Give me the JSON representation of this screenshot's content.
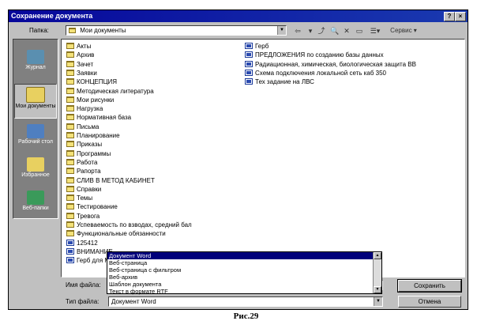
{
  "window": {
    "title": "Сохранение документа",
    "help_label": "?",
    "close_label": "×"
  },
  "location": {
    "label": "Папка:",
    "value": "Мои документы"
  },
  "toolbar": {
    "back_icon": "back-arrow-icon",
    "up_icon": "up-folder-icon",
    "search_icon": "search-web-icon",
    "delete_icon": "delete-icon",
    "new_folder_icon": "new-folder-icon",
    "views_icon": "views-icon",
    "tools_label": "Сервис"
  },
  "places": [
    {
      "label": "Журнал",
      "icon": "history-icon",
      "color": "#5a8fb0"
    },
    {
      "label": "Мои документы",
      "icon": "my-documents-icon",
      "color": "#e8d060"
    },
    {
      "label": "Рабочий стол",
      "icon": "desktop-icon",
      "color": "#4f7fc0"
    },
    {
      "label": "Избранное",
      "icon": "favorites-icon",
      "color": "#e8d060"
    },
    {
      "label": "Веб-папки",
      "icon": "web-folders-icon",
      "color": "#3a9a5a"
    }
  ],
  "files_col1": [
    {
      "name": "Акты",
      "type": "folder"
    },
    {
      "name": "Архив",
      "type": "folder"
    },
    {
      "name": "Зачет",
      "type": "folder"
    },
    {
      "name": "Заявки",
      "type": "folder"
    },
    {
      "name": "КОНЦЕПЦИЯ",
      "type": "folder"
    },
    {
      "name": "Методическая литература",
      "type": "folder"
    },
    {
      "name": "Мои рисунки",
      "type": "folder"
    },
    {
      "name": "Нагрузка",
      "type": "folder"
    },
    {
      "name": "Нормативная база",
      "type": "folder"
    },
    {
      "name": "Письма",
      "type": "folder"
    },
    {
      "name": "Планирование",
      "type": "folder"
    },
    {
      "name": "Приказы",
      "type": "folder"
    },
    {
      "name": "Программы",
      "type": "folder"
    },
    {
      "name": "Работа",
      "type": "folder"
    },
    {
      "name": "Рапорта",
      "type": "folder"
    },
    {
      "name": "СЛИВ В МЕТОД КАБИНЕТ",
      "type": "folder"
    },
    {
      "name": "Справки",
      "type": "folder"
    },
    {
      "name": "Темы",
      "type": "folder"
    },
    {
      "name": "Тестирование",
      "type": "folder"
    },
    {
      "name": "Тревога",
      "type": "folder"
    },
    {
      "name": "Успеваемость по взводах, средний бал",
      "type": "folder"
    },
    {
      "name": "Функциональные обязанности",
      "type": "folder"
    },
    {
      "name": "125412",
      "type": "doc"
    },
    {
      "name": "ВНИМАНИЕ",
      "type": "doc"
    },
    {
      "name": "Герб для М",
      "type": "doc"
    }
  ],
  "files_col2": [
    {
      "name": "Герб",
      "type": "doc"
    },
    {
      "name": "ПРЕДЛОЖЕНИЯ по созданию базы данных",
      "type": "doc"
    },
    {
      "name": "Радиационная, химическая, биологическая защита ВВ",
      "type": "doc"
    },
    {
      "name": "Схема подключения локальной сеть каб 350",
      "type": "doc"
    },
    {
      "name": "Тех задание на ЛВС",
      "type": "doc"
    }
  ],
  "filename": {
    "label": "Имя файла:",
    "value": ""
  },
  "filetype": {
    "label": "Тип файла:",
    "value": "Документ Word",
    "options": [
      "Документ Word",
      "Веб-страница",
      "Веб-страница с фильтром",
      "Веб-архив",
      "Шаблон документа",
      "Текст в формате RTF"
    ],
    "selected_index": 0
  },
  "buttons": {
    "save": "Сохранить",
    "cancel": "Отмена"
  },
  "caption": "Рис.29"
}
